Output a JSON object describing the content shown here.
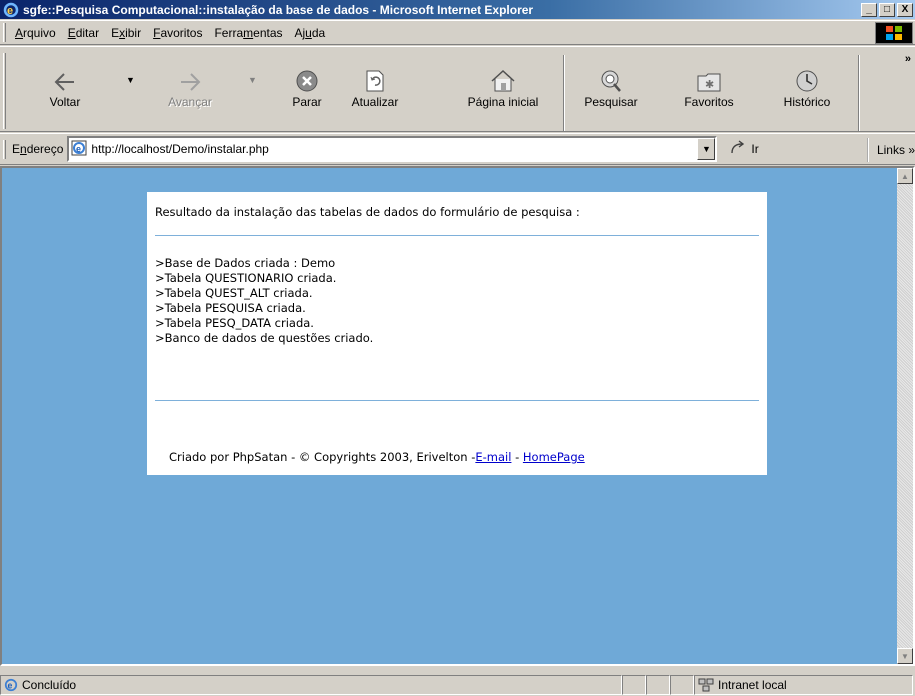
{
  "window": {
    "title": "sgfe::Pesquisa Computacional::instalação da base de dados - Microsoft Internet Explorer",
    "minimize": "_",
    "maximize": "□",
    "close": "X"
  },
  "menu": {
    "items": [
      {
        "accel": "A",
        "rest": "rquivo"
      },
      {
        "accel": "E",
        "rest": "ditar"
      },
      {
        "pre": "E",
        "accel": "x",
        "rest": "ibir"
      },
      {
        "accel": "F",
        "rest": "avoritos"
      },
      {
        "pre": "Ferra",
        "accel": "m",
        "rest": "entas"
      },
      {
        "pre": "Aj",
        "accel": "u",
        "rest": "da"
      }
    ]
  },
  "toolbar": {
    "back": "Voltar",
    "forward": "Avançar",
    "stop": "Parar",
    "refresh": "Atualizar",
    "home": "Página inicial",
    "search": "Pesquisar",
    "favorites": "Favoritos",
    "history": "Histórico",
    "more": "»"
  },
  "address": {
    "label_pre": "E",
    "label_accel": "n",
    "label_rest": "dereço",
    "url": "http://localhost/Demo/instalar.php",
    "go": "Ir",
    "links": "Links »"
  },
  "page": {
    "heading": "Resultado da instalação das tabelas de dados do formulário de pesquisa :",
    "log": [
      ">Base de Dados criada : Demo",
      ">Tabela QUESTIONARIO criada.",
      ">Tabela QUEST_ALT criada.",
      ">Tabela PESQUISA criada.",
      ">Tabela PESQ_DATA criada.",
      ">Banco de dados de questões criado."
    ],
    "footer_text": "Criado por PhpSatan - © Copyrights 2003, Erivelton -",
    "email_link": "E-mail",
    "separator": " - ",
    "homepage_link": "HomePage"
  },
  "status": {
    "text": "Concluído",
    "zone": "Intranet local"
  },
  "colors": {
    "page_background": "#6fa9d7",
    "title_gradient_start": "#0a246a",
    "link": "#0000cc"
  }
}
